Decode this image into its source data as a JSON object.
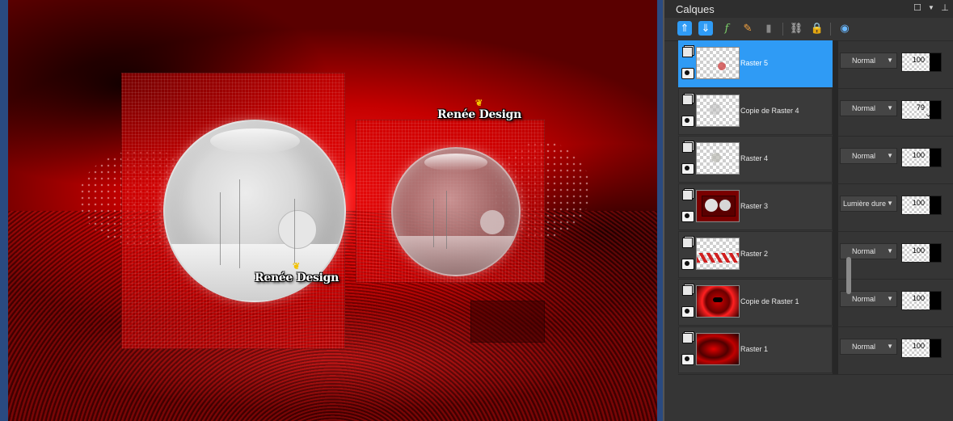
{
  "panel": {
    "title": "Calques",
    "title_icons": [
      "maximize-icon",
      "dropdown-icon",
      "pin-icon"
    ],
    "toolbar_icons": [
      "new-layer-icon",
      "merge-down-icon",
      "fx-icon",
      "edit-icon",
      "mask-icon",
      "link-icon",
      "lock-icon",
      "properties-icon"
    ],
    "accent_color": "#2f9bf5",
    "layers": [
      {
        "name": "Raster 5",
        "blend": "Normal",
        "opacity": "100",
        "selected": true
      },
      {
        "name": "Copie de Raster 4",
        "blend": "Normal",
        "opacity": "79",
        "selected": false
      },
      {
        "name": "Raster 4",
        "blend": "Normal",
        "opacity": "100",
        "selected": false
      },
      {
        "name": "Raster 3",
        "blend": "Lumière dure",
        "opacity": "100",
        "selected": false
      },
      {
        "name": "Raster 2",
        "blend": "Normal",
        "opacity": "100",
        "selected": false
      },
      {
        "name": "Copie de Raster 1",
        "blend": "Normal",
        "opacity": "100",
        "selected": false
      },
      {
        "name": "Raster 1",
        "blend": "Normal",
        "opacity": "100",
        "selected": false
      }
    ]
  },
  "canvas": {
    "watermark_1": "Renée Design",
    "watermark_2": "Renée Design"
  }
}
